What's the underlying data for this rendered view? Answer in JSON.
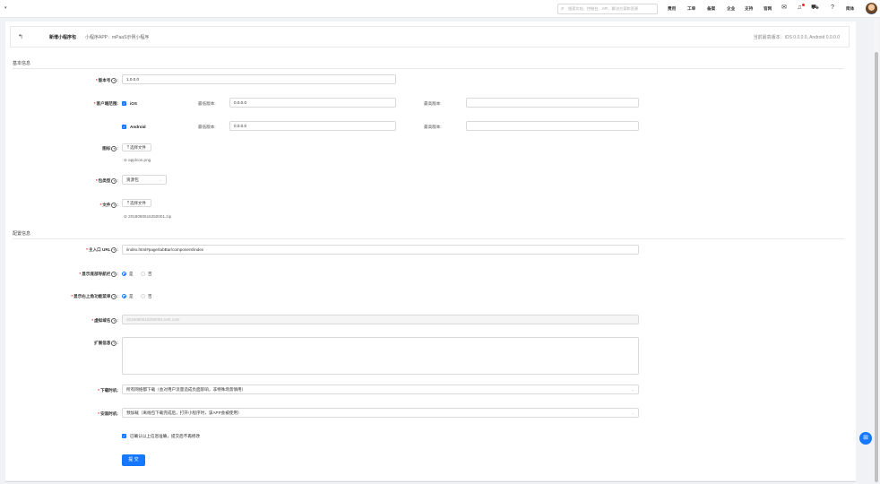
{
  "topbar": {
    "search_placeholder": "搜索文档、控制台、API、解决方案和资源",
    "nav": [
      "费用",
      "工单",
      "备案",
      "企业",
      "支持",
      "官网"
    ],
    "user": "简体"
  },
  "header": {
    "back_icon": "back-arrow-icon",
    "title": "新增小程序包",
    "subtitle": "小程序APP：mPaaS示例小程序",
    "current_version": "当前最高版本：iOS 0.0.0.0, Android 0.0.0.0"
  },
  "basic_section": "基本信息",
  "config_section": "配置信息",
  "form": {
    "version_label": "版本号",
    "version_value": "1.0.0.0",
    "client_range_label": "客户端范围:",
    "ios_label": "iOS",
    "android_label": "Android",
    "min_version_label": "最低版本:",
    "max_version_label": "最高版本:",
    "ios_min": "0.0.0.0",
    "android_min": "0.0.0.0",
    "ios_max": "",
    "android_max": "",
    "icon_label": "图标",
    "upload_button": "选择文件",
    "icon_file": "applcon.png",
    "package_type_label": "包类型",
    "package_type_value": "资源包",
    "file_label": "文件",
    "file_name": "2018080616250001.zip",
    "main_url_label": "主入口 URL",
    "main_url_value": "/index.html#page/tabBar/component/index",
    "bottom_nav_label": "显示底部导航栏",
    "top_menu_label": "显示右上角功能菜单",
    "yes": "是",
    "no": "否",
    "vhost_label": "虚拟域名",
    "vhost_value": "2018080616250001.test.com",
    "ext_label": "扩展信息",
    "download_label": "下载时机:",
    "download_value": "所有网络都下载（会对用户流量造成负面影响，非特殊场景慎用）",
    "install_label": "安装时机:",
    "install_value": "预加载（离线包下载完成后，打开小程序时，该APP会被使用）",
    "confirm_text": "已确认以上信息准确，提交后不再修改",
    "submit": "提 交"
  },
  "colors": {
    "primary": "#1677ff",
    "required": "#f5222d"
  }
}
